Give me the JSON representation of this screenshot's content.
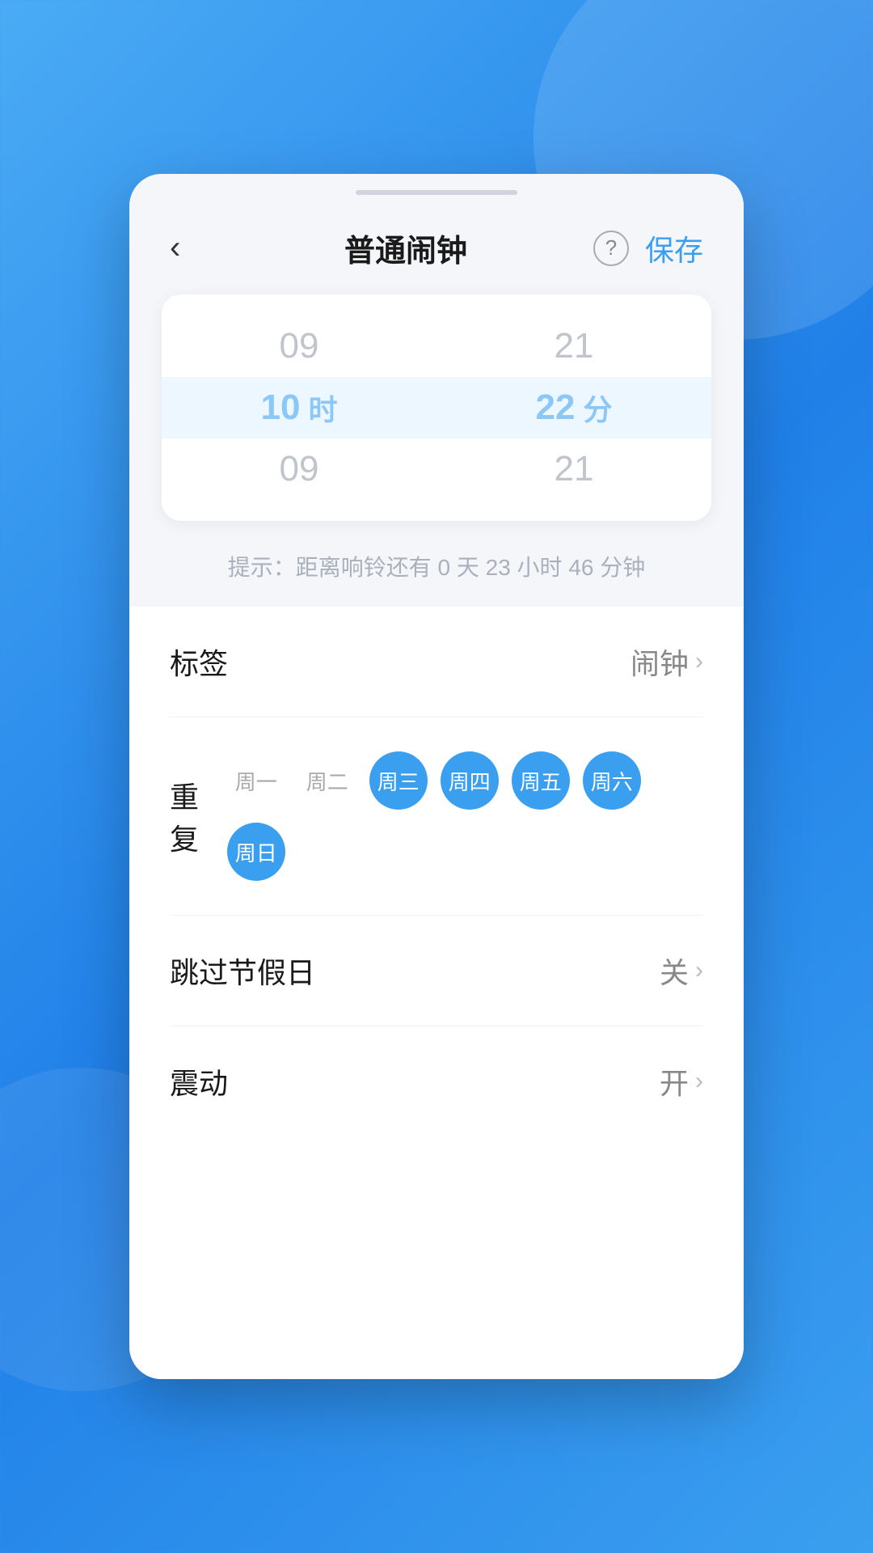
{
  "background": {
    "gradient_start": "#4AABF5",
    "gradient_end": "#2080E8"
  },
  "header": {
    "back_label": "‹",
    "title": "普通闹钟",
    "help_icon": "?",
    "save_label": "保存"
  },
  "time_picker": {
    "hour_above": "09",
    "hour_selected": "10",
    "hour_below": "09",
    "hour_unit": "时",
    "minute_above": "21",
    "minute_selected": "22",
    "minute_below": "21",
    "minute_unit": "分"
  },
  "hint": {
    "text": "提示：距离响铃还有 0 天 23 小时 46 分钟"
  },
  "settings": {
    "label_label": "标签",
    "label_value": "闹钟",
    "repeat_label": "重复",
    "days": [
      {
        "label": "周一",
        "active": false
      },
      {
        "label": "周二",
        "active": false
      },
      {
        "label": "周三",
        "active": true
      },
      {
        "label": "周四",
        "active": true
      },
      {
        "label": "周五",
        "active": true
      },
      {
        "label": "周六",
        "active": true
      },
      {
        "label": "周日",
        "active": true
      }
    ],
    "holiday_label": "跳过节假日",
    "holiday_value": "关",
    "vibrate_label": "震动",
    "vibrate_value": "开"
  }
}
